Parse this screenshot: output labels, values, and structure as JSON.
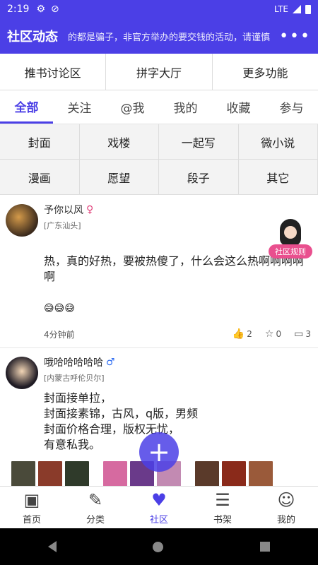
{
  "status_bar": {
    "time": "2:19",
    "network": "LTE"
  },
  "app_bar": {
    "title": "社区动态",
    "marquee": "的都是骗子，非官方举办的要交钱的活动，请谨慎",
    "more": "•••"
  },
  "top_buttons": [
    "推书讨论区",
    "拼字大厅",
    "更多功能"
  ],
  "tabs": [
    "全部",
    "关注",
    "@我",
    "我的",
    "收藏",
    "参与"
  ],
  "active_tab": "全部",
  "categories": [
    "封面",
    "戏楼",
    "一起写",
    "微小说",
    "漫画",
    "愿望",
    "段子",
    "其它"
  ],
  "floating": {
    "community_rules": "社区规则",
    "add": "+"
  },
  "posts": [
    {
      "username": "予你以风",
      "location": "[广东汕头]",
      "content": "热，真的好热，要被热傻了，什么会这么热啊啊啊啊啊",
      "emojis": "😅😅😅",
      "time": "4分钟前",
      "likes": "2",
      "stars": "0",
      "comments": "3"
    },
    {
      "username": "哦哈哈哈哈哈",
      "location": "[内蒙古呼伦贝尔]",
      "content": "封面接单拉，\n封面接素锦，古风，q版，男频\n封面价格合理，版权无忧，\n有意私我。"
    }
  ],
  "bottom_nav": [
    "首页",
    "分类",
    "社区",
    "书架",
    "我的"
  ],
  "active_nav": "社区",
  "colors": {
    "accent": "#4b3fe6",
    "rules_badge": "#e94f8e"
  }
}
